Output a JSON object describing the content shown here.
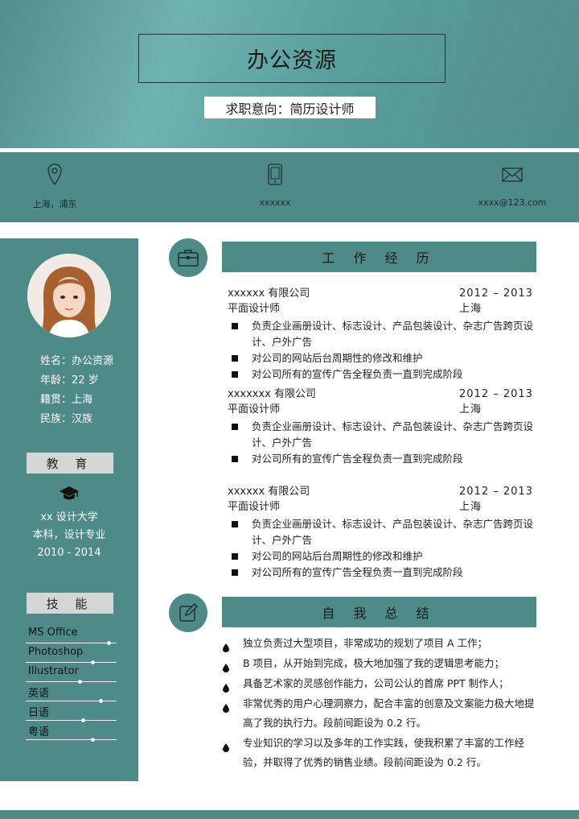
{
  "header": {
    "name": "办公资源",
    "intent": "求职意向：简历设计师"
  },
  "contact": {
    "location": {
      "icon": "location-pin-icon",
      "text": "上海，浦东"
    },
    "phone": {
      "icon": "phone-icon",
      "text": "xxxxxx"
    },
    "email": {
      "icon": "mail-icon",
      "text": "xxxx@123.com"
    }
  },
  "profile": {
    "name_line": "姓名：办公资源",
    "age_line": "年龄：22 岁",
    "origin_line": "籍贯：上海",
    "ethnicity_line": "民族：汉族"
  },
  "education": {
    "title": "教 育",
    "icon": "graduation-cap-icon",
    "school": "xx 设计大学",
    "degree": "本科，设计专业",
    "years": "2010 - 2014"
  },
  "skills": {
    "title": "技 能",
    "items": [
      {
        "label": "MS Office",
        "level": 0.92
      },
      {
        "label": "Photoshop",
        "level": 0.74
      },
      {
        "label": "Illustrator",
        "level": 0.6
      },
      {
        "label": "英语",
        "level": 0.83
      },
      {
        "label": "日语",
        "level": 0.63
      },
      {
        "label": "粤语",
        "level": 0.74
      }
    ]
  },
  "work": {
    "title": "工 作 经 历",
    "icon": "briefcase-icon",
    "jobs": [
      {
        "company": "xxxxxx 有限公司",
        "period": "2012 – 2013",
        "position": "平面设计师",
        "city": "上海",
        "duties": [
          "负责企业画册设计、标志设计、产品包装设计、杂志广告跨页设计、户外广告",
          "对公司的网站后台周期性的修改和维护",
          "对公司所有的宣传广告全程负责一直到完成阶段"
        ]
      },
      {
        "company": "xxxxxxx 有限公司",
        "period": "2012 – 2013",
        "position": "平面设计师",
        "city": "上海",
        "duties": [
          "负责企业画册设计、标志设计、产品包装设计、杂志广告跨页设计、户外广告",
          "对公司所有的宣传广告全程负责一直到完成阶段"
        ]
      },
      {
        "company": "xxxxxx 有限公司",
        "period": "2012 – 2013",
        "position": "平面设计师",
        "city": "上海",
        "duties": [
          "负责企业画册设计、标志设计、产品包装设计、杂志广告跨页设计、户外广告",
          "对公司的网站后台周期性的修改和维护",
          "对公司所有的宣传广告全程负责一直到完成阶段"
        ]
      }
    ]
  },
  "summary": {
    "title": "自 我 总 结",
    "icon": "edit-icon",
    "items": [
      "独立负责过大型项目，非常成功的规划了项目 A 工作；",
      "B 项目，从开始到完成，极大地加强了我的逻辑思考能力；",
      "具备艺术家的灵感创作能力，公司公认的首席 PPT 制作人；",
      "非常优秀的用户心理洞察力，配合丰富的创意及文案能力极大地提高了我的执行力。段前间距设为 0.2 行。",
      "专业知识的学习以及多年的工作实践，使我积累了丰富的工作经验，并取得了优秀的销售业绩。段前间距设为 0.2 行。"
    ]
  },
  "colors": {
    "accent": "#4e8a87",
    "header_light": "#6fb3b0",
    "label_bg": "#d6d6d6"
  }
}
